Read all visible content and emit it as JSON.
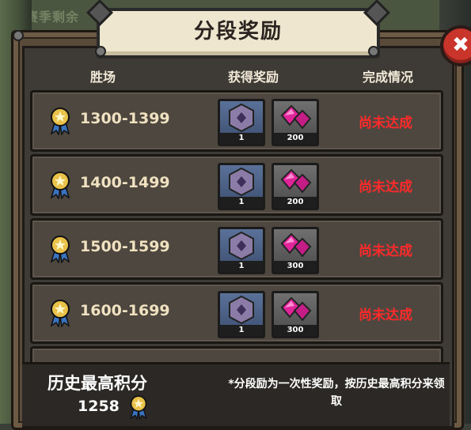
{
  "background": {
    "blurred_text": "赛季剩余"
  },
  "title": "分段奖励",
  "close_icon": "✖",
  "columns": {
    "wins": "胜场",
    "rewards": "获得奖励",
    "status": "完成情况"
  },
  "rows": [
    {
      "range": "1300-1399",
      "box_count": "1",
      "gem_count": "200",
      "status": "尚未达成"
    },
    {
      "range": "1400-1499",
      "box_count": "1",
      "gem_count": "200",
      "status": "尚未达成"
    },
    {
      "range": "1500-1599",
      "box_count": "1",
      "gem_count": "300",
      "status": "尚未达成"
    },
    {
      "range": "1600-1699",
      "box_count": "1",
      "gem_count": "300",
      "status": "尚未达成"
    }
  ],
  "footer": {
    "history_label": "历史最高积分",
    "history_score": "1258",
    "note": "*分段励为一次性奖励，按历史最高积分来领取"
  },
  "colors": {
    "status_red": "#ff2a2a",
    "gem_pink": "#e0249a",
    "box_blue": "#5a7198"
  }
}
